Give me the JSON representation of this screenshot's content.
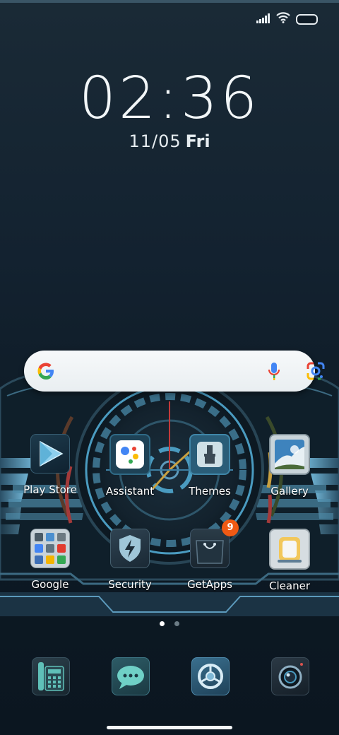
{
  "status_bar": {
    "signal_icon": "signal-bars-icon",
    "wifi_icon": "wifi-icon",
    "battery_icon": "battery-icon"
  },
  "lock": {
    "time": "02:36",
    "date": "11/05",
    "weekday": "Fri"
  },
  "search": {
    "logo_icon": "google-g-icon",
    "mic_icon": "microphone-icon",
    "lens_icon": "google-lens-icon"
  },
  "apps": [
    {
      "label": "Play Store",
      "icon": "play-store-icon"
    },
    {
      "label": "Assistant",
      "icon": "assistant-icon"
    },
    {
      "label": "Themes",
      "icon": "themes-brush-icon"
    },
    {
      "label": "Gallery",
      "icon": "gallery-icon"
    },
    {
      "label": "Google",
      "icon": "google-folder-icon"
    },
    {
      "label": "Security",
      "icon": "security-shield-icon"
    },
    {
      "label": "GetApps",
      "icon": "getapps-bag-icon",
      "badge": "9"
    },
    {
      "label": "Cleaner",
      "icon": "cleaner-icon"
    }
  ],
  "page_indicator": {
    "pages": 2,
    "current": 1
  },
  "dock": [
    {
      "icon": "phone-icon"
    },
    {
      "icon": "messages-icon"
    },
    {
      "icon": "browser-icon"
    },
    {
      "icon": "camera-icon"
    }
  ],
  "colors": {
    "accent_blue": "#4a9bc0",
    "badge_orange": "#f05a14",
    "gauge_red": "#a33a3a",
    "gauge_gold": "#c8a040"
  }
}
